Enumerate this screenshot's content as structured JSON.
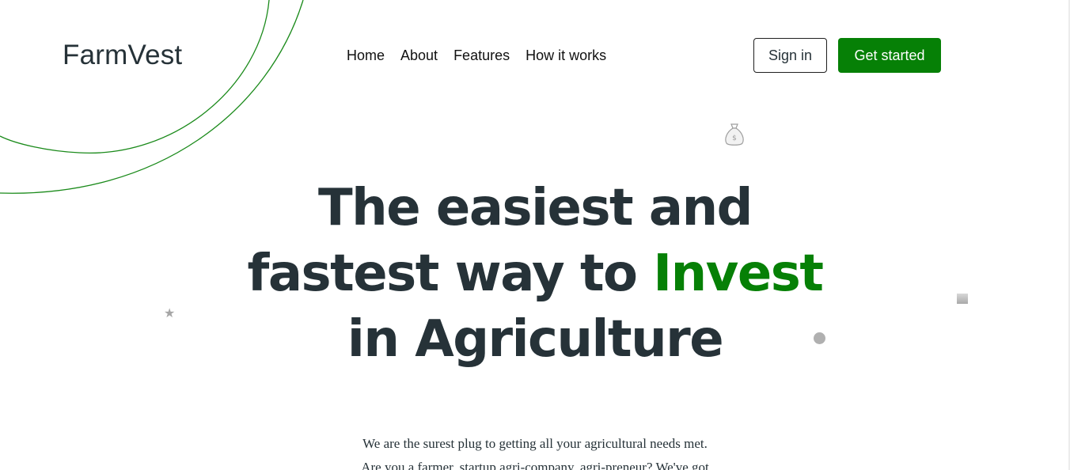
{
  "brand": {
    "name": "FarmVest"
  },
  "nav": {
    "items": [
      {
        "label": "Home"
      },
      {
        "label": "About"
      },
      {
        "label": "Features"
      },
      {
        "label": "How it works"
      }
    ]
  },
  "header_actions": {
    "signin_label": "Sign in",
    "get_started_label": "Get started"
  },
  "hero": {
    "line1": "The easiest and",
    "line2_prefix": "fastest way to ",
    "line2_accent": "Invest",
    "line3": "in Agriculture"
  },
  "intro": {
    "line1": "We are the surest plug to getting all your agricultural needs met.",
    "line2": "Are you a farmer, startup agri-company, agri-preneur? We've got"
  },
  "decorations": {
    "icons": [
      "money-bag-icon",
      "star-icon",
      "dot-icon",
      "square-icon"
    ],
    "colors": {
      "accent": "#068006",
      "text": "#263238",
      "arc": "#1a8a1a"
    }
  }
}
